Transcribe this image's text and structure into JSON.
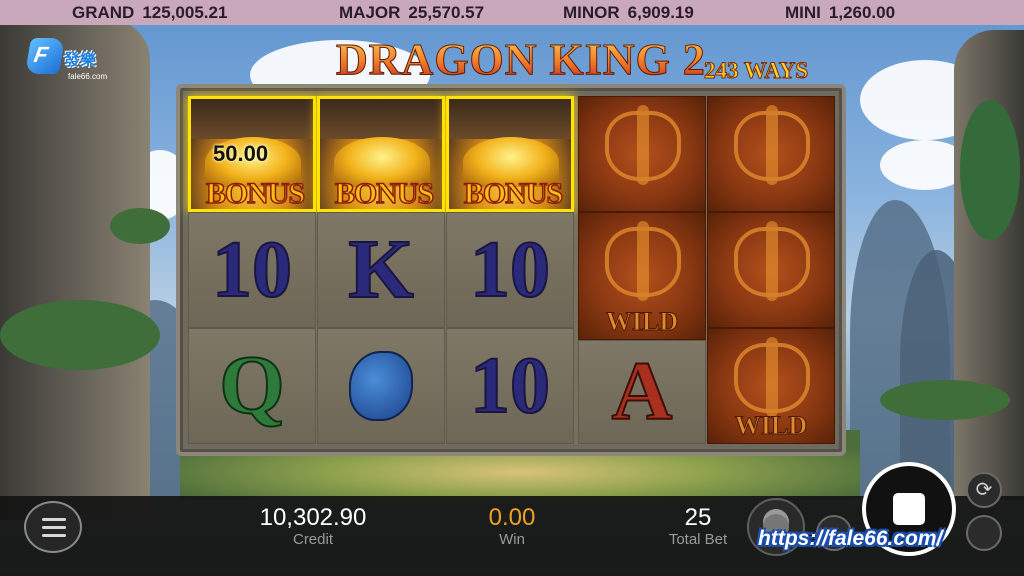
{
  "jackpots": [
    {
      "label": "GRAND",
      "value": "125,005.21"
    },
    {
      "label": "MAJOR",
      "value": "25,570.57"
    },
    {
      "label": "MINOR",
      "value": "6,909.19"
    },
    {
      "label": "MINI",
      "value": "1,260.00"
    }
  ],
  "logo": {
    "letter": "F",
    "name": "發樂",
    "small": "fale66.com"
  },
  "game": {
    "title": "DRAGON KING 2",
    "ways": "243 WAYS"
  },
  "reels": {
    "bonus_word": "BONUS",
    "bonus_amount": "50.00",
    "row2": [
      "10",
      "K",
      "10"
    ],
    "row3": [
      "Q",
      "",
      "10",
      "A"
    ],
    "wild_label": "WILD"
  },
  "footer": {
    "credit_value": "10,302.90",
    "credit_label": "Credit",
    "win_value": "0.00",
    "win_label": "Win",
    "bet_value": "25",
    "bet_label": "Total Bet",
    "url": "https://fale66.com/"
  },
  "icons": {
    "menu": "hamburger-icon",
    "spin": "stop-icon",
    "autoplay": "refresh-icon",
    "coins": "coin-stack-icon"
  }
}
